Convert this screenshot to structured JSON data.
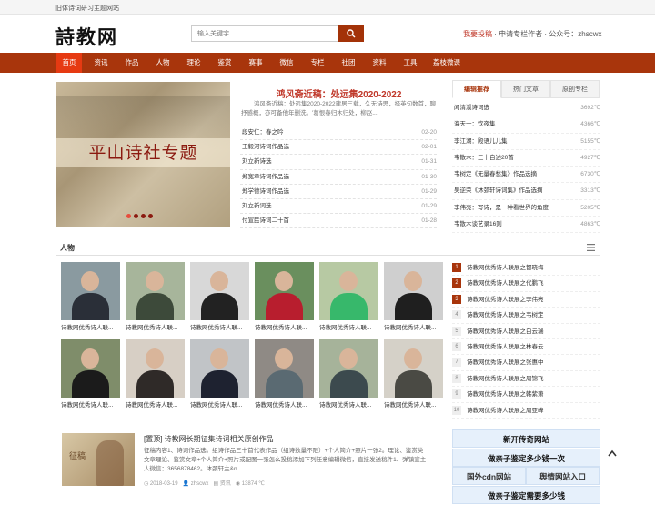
{
  "topbar": {
    "text": "旧体诗词研习主题网站"
  },
  "header": {
    "logo": "詩教网",
    "search_placeholder": "输入关键字",
    "submit_link": "我要投稿",
    "apply_link": "申请专栏作者",
    "wechat": "公众号：zhscwx"
  },
  "nav": {
    "items": [
      "首页",
      "资讯",
      "作品",
      "人物",
      "理论",
      "鉴赏",
      "赛事",
      "微信",
      "专栏",
      "社团",
      "资料",
      "工具",
      "荔枝微课"
    ]
  },
  "banner": {
    "title": "平山诗社专题"
  },
  "headline": {
    "title": "鸿风斋近稿：处远集2020-2022",
    "summary": "鸿风斋近稿：处远集2020-2022建居三载，久无诗思，择英句数首，聊抒感概，亦可备他年删洗。'葛恨春归木归处，柳赵..."
  },
  "news": [
    {
      "title": "段安仁：春之吟",
      "date": "02-20"
    },
    {
      "title": "王毅河诗词作品选",
      "date": "02-01"
    },
    {
      "title": "刘立新诗选",
      "date": "01-31"
    },
    {
      "title": "郑宽章诗词作品选",
      "date": "01-30"
    },
    {
      "title": "郑学德诗词作品选",
      "date": "01-29"
    },
    {
      "title": "刘立新词选",
      "date": "01-29"
    },
    {
      "title": "付宣民诗词二十首",
      "date": "01-28"
    }
  ],
  "tabs": [
    "编辑推荐",
    "热门文章",
    "原创专栏"
  ],
  "recommend": [
    {
      "title": "闻清溪诗词选",
      "views": "3692℃"
    },
    {
      "title": "海天一：饮夜集",
      "views": "4366℃"
    },
    {
      "title": "李江湖：殿语儿儿集",
      "views": "5155℃"
    },
    {
      "title": "韦散木：三十自述20首",
      "views": "4927℃"
    },
    {
      "title": "韦树定《无量春愁集》作品选摘",
      "views": "6730℃"
    },
    {
      "title": "吴逆荣《沐颈轩诗词集》作品选摘",
      "views": "3313℃"
    },
    {
      "title": "李伟亮：写诗，是一种看世界的角度",
      "views": "5205℃"
    },
    {
      "title": "韦散木谈艺录16则",
      "views": "4863℃"
    }
  ],
  "section": {
    "title": "人物"
  },
  "people_caption": "诗教网优秀诗人联...",
  "people_colors": [
    {
      "bg": "#8a9aa0",
      "coat": "#2a2f38"
    },
    {
      "bg": "#a7b59b",
      "coat": "#3d4a3a"
    },
    {
      "bg": "#d8d8d8",
      "coat": "#222222"
    },
    {
      "bg": "#6a8f5e",
      "coat": "#b81e2e"
    },
    {
      "bg": "#b7c9a3",
      "coat": "#37b86b"
    },
    {
      "bg": "#cfcfcf",
      "coat": "#1f1f1f"
    },
    {
      "bg": "#7f8d6a",
      "coat": "#1b1b1b"
    },
    {
      "bg": "#d7cfc5",
      "coat": "#2f2a28"
    },
    {
      "bg": "#c1c4c7",
      "coat": "#1e2230"
    },
    {
      "bg": "#8f8a85",
      "coat": "#5a6a72"
    },
    {
      "bg": "#a6b39a",
      "coat": "#3c4a4e"
    },
    {
      "bg": "#d5d1c8",
      "coat": "#4a4a44"
    }
  ],
  "ranking": [
    "诗教网优秀诗人联展之都晓梅",
    "诗教网优秀诗人联展之代鹏飞",
    "诗教网优秀诗人联展之李伟亮",
    "诗教网优秀诗人联展之韦树定",
    "诗教网优秀诗人联展之白云瑞",
    "诗教网优秀诗人联展之林春云",
    "诗教网优秀诗人联展之张惠中",
    "诗教网优秀诗人联展之周锦飞",
    "诗教网优秀诗人联展之韩紫箫",
    "诗教网优秀诗人联展之周亚峰"
  ],
  "article": {
    "thumb_label": "征稿",
    "title": "[置顶] 诗教网长期征集诗词相关原创作品",
    "text": "征稿内容1、诗词作品选。组诗作品三十首代表作品（组诗数量不限）+个人简介+照片一张2。理论、鉴赏类文章理论、鉴赏文章+个人简介+照片或配图一张怎么投稿添加下列任意编辑微信，直接发送稿件1、弹镇宣主人微信：3656878462。沐颈轩主&n...",
    "date": "2018-03-19",
    "author": "zhscwx",
    "category": "资讯",
    "views": "13874 ℃"
  },
  "links": {
    "l1": "新开传奇网站",
    "l2": "做亲子鉴定多少钱一次",
    "l3": "国外cdn网站",
    "l4": "舆情网站入口",
    "l5": "做亲子鉴定需要多少钱"
  },
  "colors": {
    "brand": "#a8350c",
    "accent": "#e63a12",
    "red": "#c0392b"
  }
}
